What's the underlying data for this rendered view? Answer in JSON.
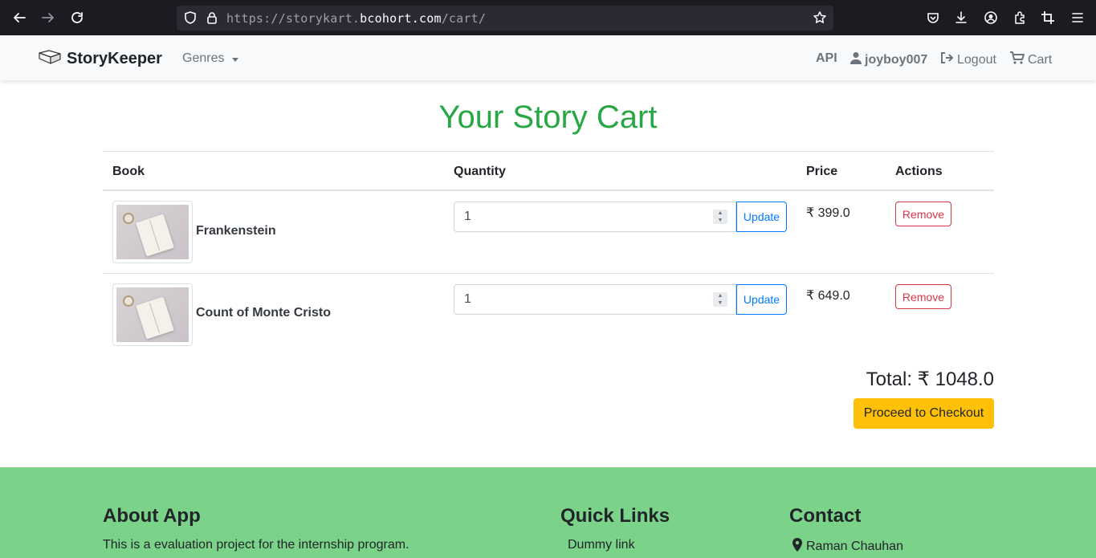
{
  "browser": {
    "url_prefix": "https://storykart.",
    "url_host": "bcohort.com",
    "url_path": "/cart/"
  },
  "navbar": {
    "brand": "StoryKeeper",
    "genres_label": "Genres",
    "api_label": "API",
    "user_label": "joyboy007",
    "logout_label": "Logout",
    "cart_label": "Cart"
  },
  "page": {
    "title": "Your Story Cart"
  },
  "table": {
    "headers": {
      "book": "Book",
      "quantity": "Quantity",
      "price": "Price",
      "actions": "Actions"
    },
    "rows": [
      {
        "book": "Frankenstein",
        "quantity": "1",
        "price": "₹ 399.0",
        "update_label": "Update",
        "remove_label": "Remove"
      },
      {
        "book": "Count of Monte Cristo",
        "quantity": "1",
        "price": "₹ 649.0",
        "update_label": "Update",
        "remove_label": "Remove"
      }
    ]
  },
  "summary": {
    "total": "Total: ₹ 1048.0",
    "checkout_label": "Proceed to Checkout"
  },
  "footer": {
    "about_title": "About App",
    "about_text": "This is a evaluation project for the internship program.",
    "links_title": "Quick Links",
    "link_1": "Dummy link",
    "contact_title": "Contact",
    "contact_name": "Raman Chauhan"
  },
  "colors": {
    "title_green": "#28a745",
    "footer_green": "#7bd389",
    "checkout_yellow": "#ffc107",
    "update_blue": "#007bff",
    "remove_red": "#dc3545"
  }
}
